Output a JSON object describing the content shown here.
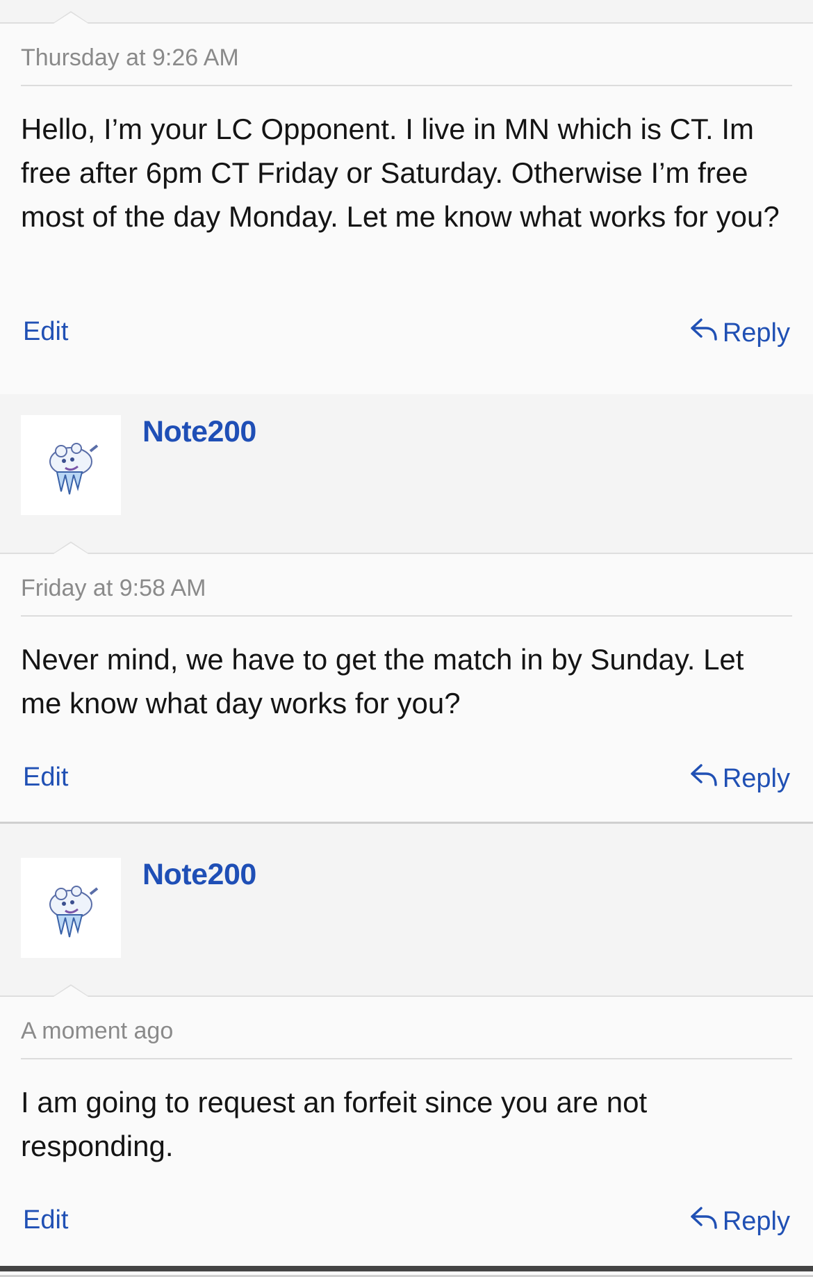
{
  "messages": [
    {
      "timestamp": "Thursday at 9:26 AM",
      "text": "Hello, I’m your LC Opponent. I live in MN which is CT. Im free after 6pm CT Friday or Saturday. Otherwise I’m free most of the day Monday. Let me know what works for you?",
      "edit_label": "Edit",
      "reply_label": "Reply"
    },
    {
      "author": "Note200",
      "timestamp": "Friday at 9:58 AM",
      "text": "Never mind, we have to get the match in by Sunday. Let me know what day works for you?",
      "edit_label": "Edit",
      "reply_label": "Reply"
    },
    {
      "author": "Note200",
      "timestamp": "A moment ago",
      "text": "I am going to request an forfeit since you are not responding.",
      "edit_label": "Edit",
      "reply_label": "Reply"
    }
  ],
  "colors": {
    "link": "#2050b4",
    "username": "#1f4fb6",
    "timestamp": "#8a8a8a"
  },
  "icons": {
    "reply": "reply-arrow-icon",
    "avatar": "pokemon-sprite-avatar"
  }
}
